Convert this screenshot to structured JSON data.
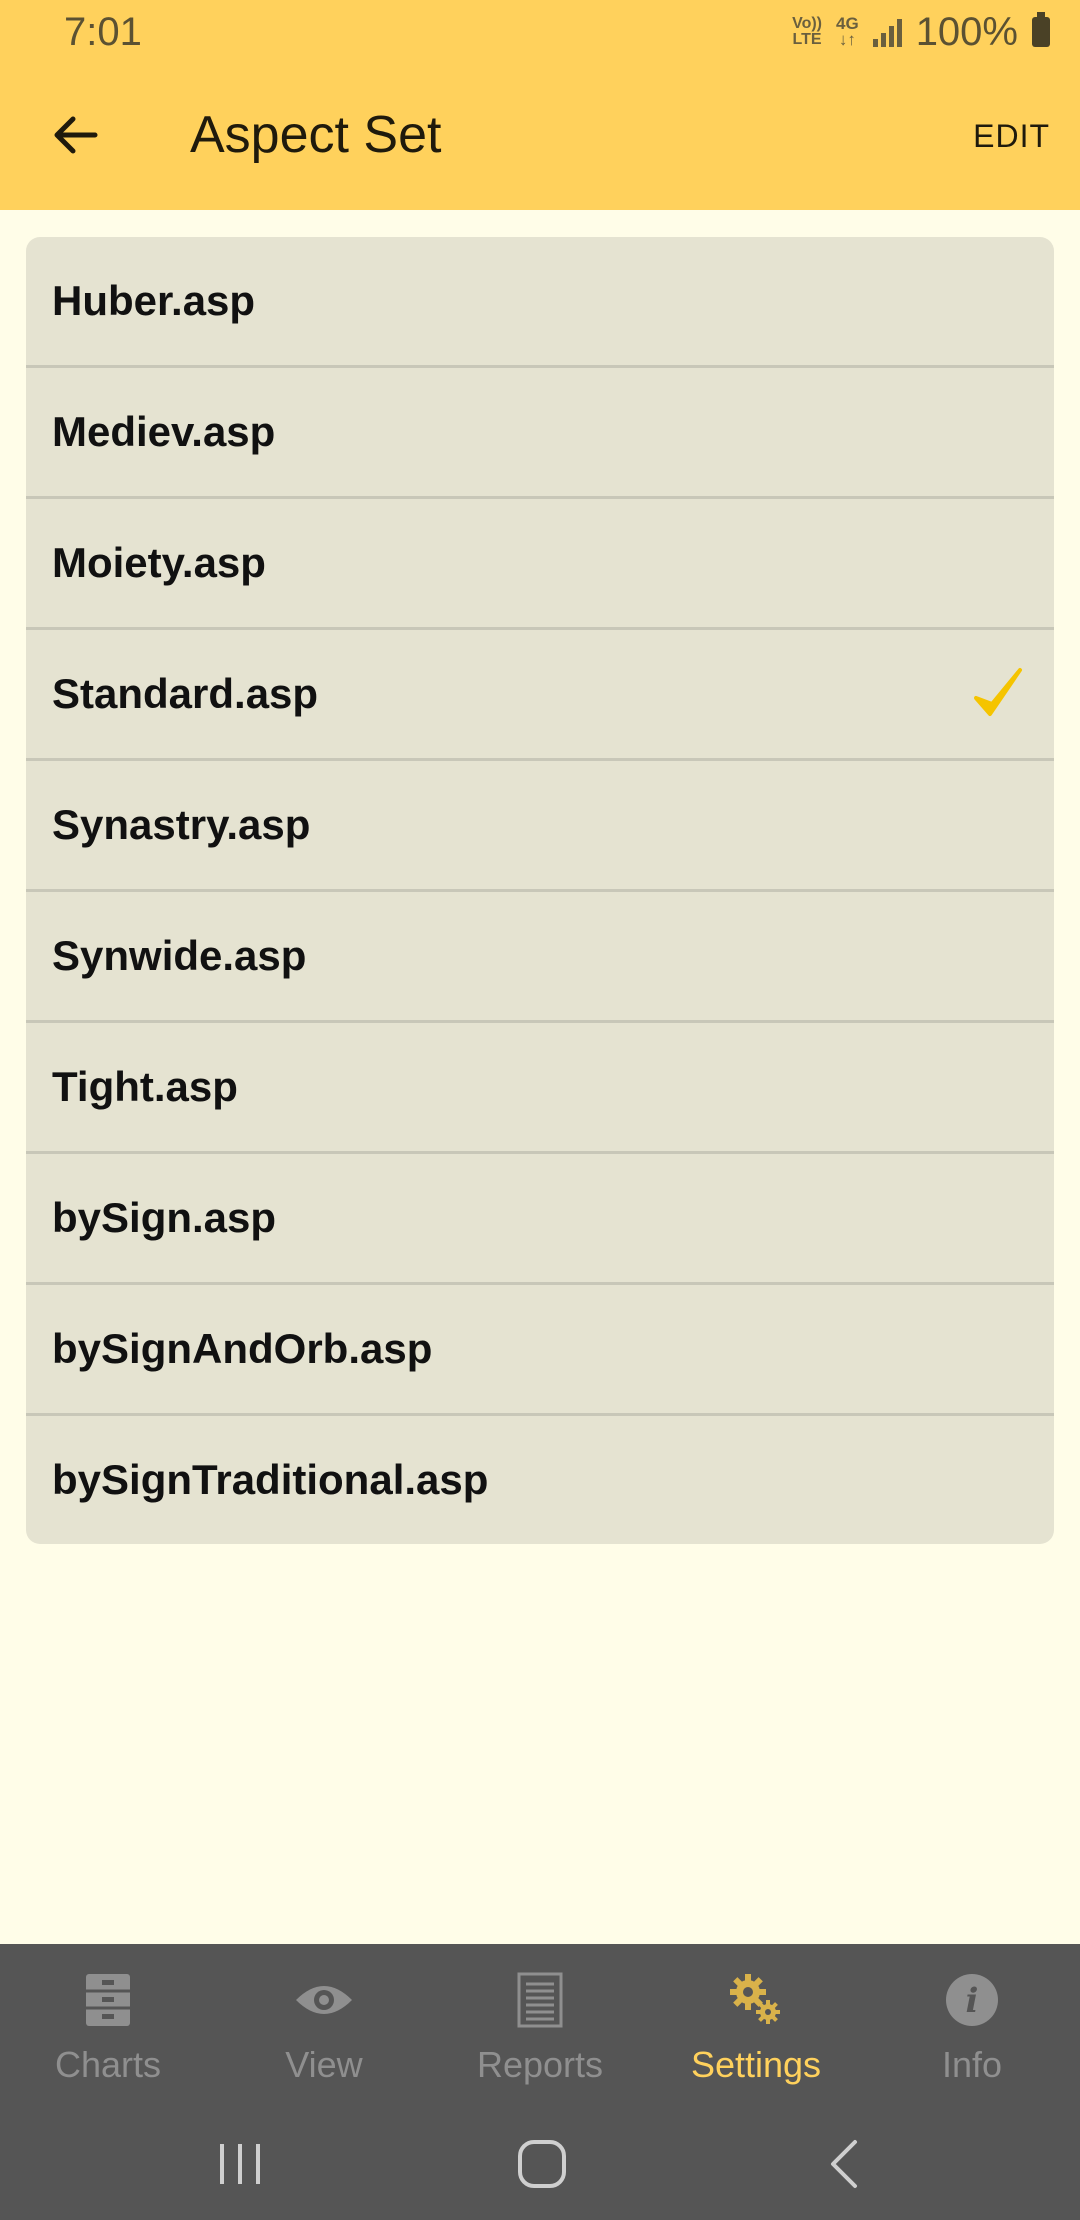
{
  "status_bar": {
    "time": "7:01",
    "volte": "Vo))\nLTE",
    "network": "4G",
    "battery": "100%"
  },
  "app_bar": {
    "title": "Aspect Set",
    "edit_label": "EDIT",
    "back_icon": "arrow-left-icon"
  },
  "aspect_sets": [
    {
      "label": "Huber.asp",
      "selected": false
    },
    {
      "label": "Mediev.asp",
      "selected": false
    },
    {
      "label": "Moiety.asp",
      "selected": false
    },
    {
      "label": "Standard.asp",
      "selected": true
    },
    {
      "label": "Synastry.asp",
      "selected": false
    },
    {
      "label": "Synwide.asp",
      "selected": false
    },
    {
      "label": "Tight.asp",
      "selected": false
    },
    {
      "label": "bySign.asp",
      "selected": false
    },
    {
      "label": "bySignAndOrb.asp",
      "selected": false
    },
    {
      "label": "bySignTraditional.asp",
      "selected": false
    }
  ],
  "bottom_nav": [
    {
      "label": "Charts",
      "icon": "file-cabinet-icon",
      "active": false
    },
    {
      "label": "View",
      "icon": "eye-icon",
      "active": false
    },
    {
      "label": "Reports",
      "icon": "document-icon",
      "active": false
    },
    {
      "label": "Settings",
      "icon": "gears-icon",
      "active": true
    },
    {
      "label": "Info",
      "icon": "info-icon",
      "active": false
    }
  ],
  "colors": {
    "app_bar": "#ffd15c",
    "background": "#fffde8",
    "list_bg": "#e5e3d1",
    "nav_bg": "#555555",
    "accent": "#ffd15c",
    "check": "#f5c400"
  }
}
